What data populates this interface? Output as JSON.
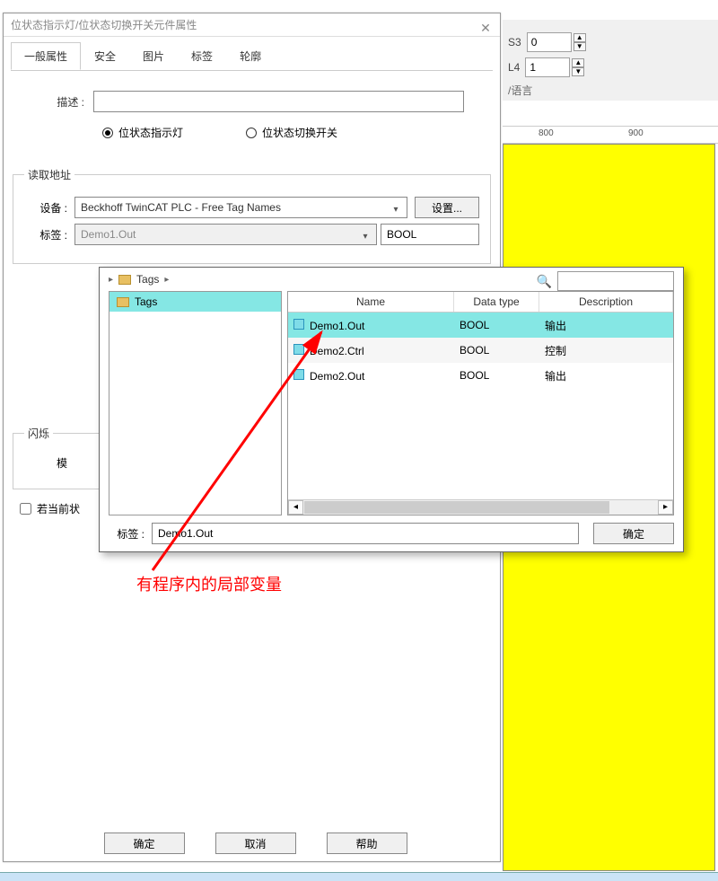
{
  "side": {
    "s3_label": "S3",
    "s3_value": "0",
    "l4_label": "L4",
    "l4_value": "1",
    "lang": "/语言",
    "ruler_800": "800",
    "ruler_900": "900"
  },
  "dialog": {
    "title": "位状态指示灯/位状态切换开关元件属性",
    "tabs": [
      "一般属性",
      "安全",
      "图片",
      "标签",
      "轮廓"
    ],
    "desc_label": "描述 :",
    "radio_indicator": "位状态指示灯",
    "radio_switch": "位状态切换开关",
    "read_group": "读取地址",
    "device_label": "设备 :",
    "device_value": "Beckhoff TwinCAT PLC - Free Tag Names",
    "settings_btn": "设置...",
    "tag_label": "标签 :",
    "tag_value": "Demo1.Out",
    "type_value": "BOOL",
    "blink_group": "闪烁",
    "mode_label": "模",
    "check_label": "若当前状",
    "footer": {
      "ok": "确定",
      "cancel": "取消",
      "help": "帮助"
    }
  },
  "popup": {
    "crumb_root": "Tags",
    "tree_root": "Tags",
    "headers": {
      "name": "Name",
      "type": "Data type",
      "desc": "Description"
    },
    "rows": [
      {
        "name": "Demo1.Out",
        "type": "BOOL",
        "desc": "输出",
        "sel": true
      },
      {
        "name": "Demo2.Ctrl",
        "type": "BOOL",
        "desc": "控制",
        "sel": false
      },
      {
        "name": "Demo2.Out",
        "type": "BOOL",
        "desc": "输出",
        "sel": false
      }
    ],
    "foot_label": "标签 :",
    "foot_value": "Demo1.Out",
    "foot_ok": "确定"
  },
  "annotation": "有程序内的局部变量"
}
